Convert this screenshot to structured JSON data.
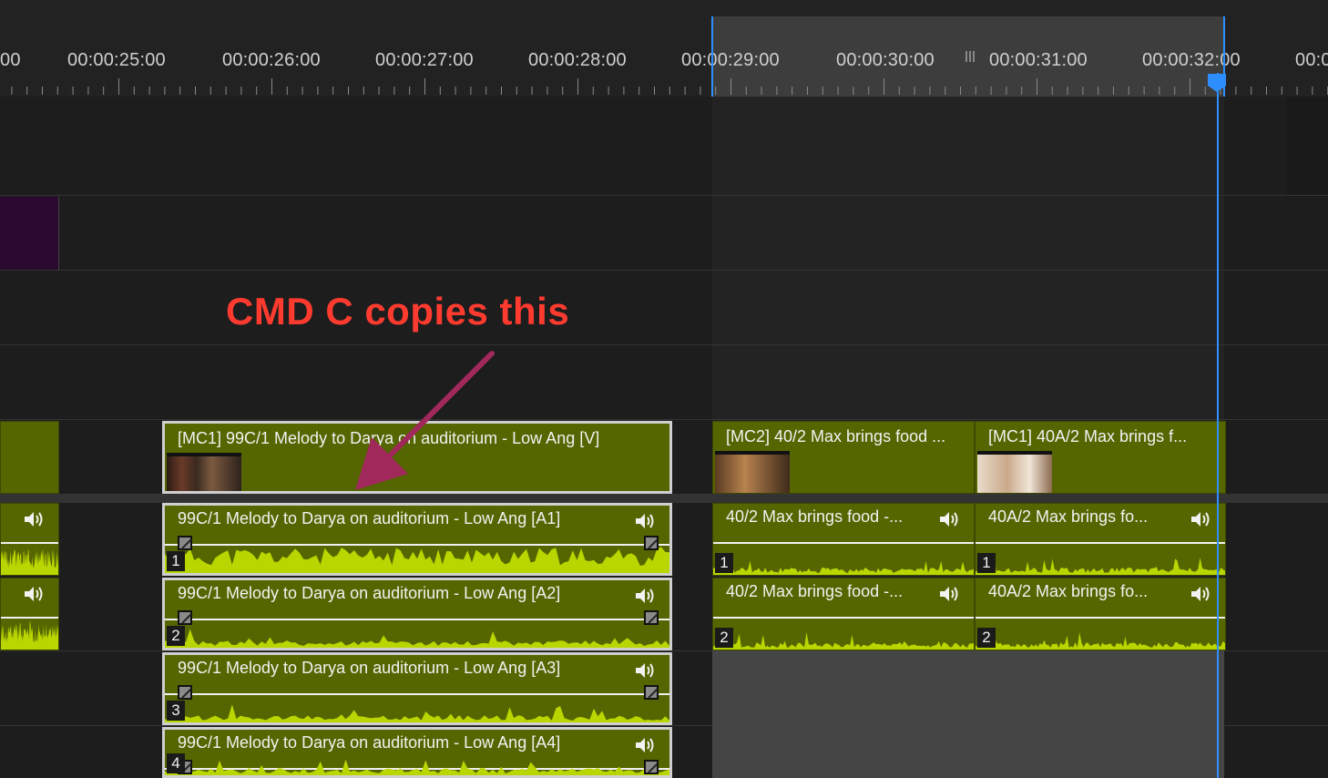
{
  "ruler": {
    "timecodes": [
      "00",
      "00:00:25:00",
      "00:00:26:00",
      "00:00:27:00",
      "00:00:28:00",
      "00:00:29:00",
      "00:00:30:00",
      "00:00:31:00",
      "00:00:32:00",
      "00:0"
    ]
  },
  "annotation": {
    "text": "CMD C copies this",
    "color": "#ff3b30"
  },
  "video_clips": [
    {
      "label": "[MC1] 99C/1 Melody to Darya on auditorium - Low Ang [V]",
      "selected": true
    },
    {
      "label": "[MC2] 40/2 Max brings food ...",
      "selected": false
    },
    {
      "label": "[MC1] 40A/2 Max brings f...",
      "selected": false
    }
  ],
  "audio_tracks": [
    {
      "channel": "1",
      "clips": [
        {
          "label": "99C/1 Melody to Darya on auditorium - Low Ang [A1]",
          "selected": true
        },
        {
          "label": "40/2 Max brings food -...",
          "selected": false
        },
        {
          "label": "40A/2 Max brings fo...",
          "selected": false
        }
      ]
    },
    {
      "channel": "2",
      "clips": [
        {
          "label": "99C/1 Melody to Darya on auditorium - Low Ang [A2]",
          "selected": true
        },
        {
          "label": "40/2 Max brings food -...",
          "selected": false
        },
        {
          "label": "40A/2 Max brings fo...",
          "selected": false
        }
      ]
    },
    {
      "channel": "3",
      "clips": [
        {
          "label": "99C/1 Melody to Darya on auditorium - Low Ang [A3]",
          "selected": true
        }
      ]
    },
    {
      "channel": "4",
      "clips": [
        {
          "label": "99C/1 Melody to Darya on auditorium - Low Ang [A4]",
          "selected": true
        }
      ]
    }
  ],
  "colors": {
    "clip_fill": "#556600",
    "waveform": "#b9d600",
    "playhead": "#2d8fff",
    "nested_sequence": "#2a0a2e"
  },
  "icons": [
    "speaker-icon",
    "keyframe-icon",
    "playhead-icon",
    "arrow-annotation-icon"
  ]
}
